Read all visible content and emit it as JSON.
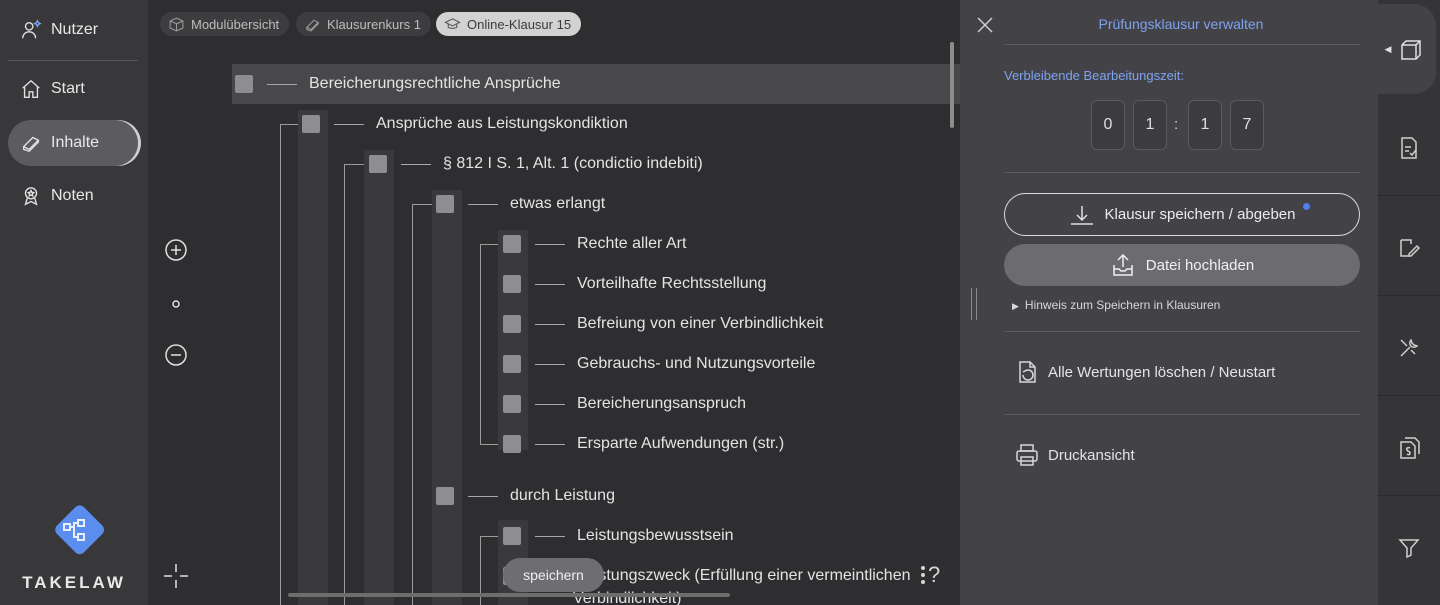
{
  "sidebar": {
    "items": [
      {
        "label": "Nutzer",
        "icon": "user-icon"
      },
      {
        "label": "Start",
        "icon": "home-icon"
      },
      {
        "label": "Inhalte",
        "icon": "book-icon",
        "active": true
      },
      {
        "label": "Noten",
        "icon": "award-icon"
      }
    ],
    "brand": "TAKELAW"
  },
  "breadcrumb": [
    "Modulübersicht",
    "Klausurenkurs 1",
    "Online-Klausur 15"
  ],
  "tree": [
    {
      "label": "Bereicherungsrechtliche Ansprüche",
      "level": 0
    },
    {
      "label": "Ansprüche aus Leistungskondiktion",
      "level": 1
    },
    {
      "label": "§ 812 I S. 1, Alt. 1 (condictio indebiti)",
      "level": 2
    },
    {
      "label": "etwas erlangt",
      "level": 3
    },
    {
      "label": "Rechte aller Art",
      "level": 4
    },
    {
      "label": "Vorteilhafte Rechtsstellung",
      "level": 4
    },
    {
      "label": "Befreiung von einer Verbindlichkeit",
      "level": 4
    },
    {
      "label": "Gebrauchs- und Nutzungsvorteile",
      "level": 4
    },
    {
      "label": "Bereicherungsanspruch",
      "level": 4
    },
    {
      "label": "Ersparte Aufwendungen (str.)",
      "level": 4
    },
    {
      "label": "durch Leistung",
      "level": 3
    },
    {
      "label": "Leistungsbewusstsein",
      "level": 4
    },
    {
      "label": "Leistungszweck (Erfüllung einer vermeintlichen",
      "level": 4
    },
    {
      "label": "Verbindlichkeit)",
      "level": 4
    }
  ],
  "canvas": {
    "save_label": "speichern",
    "help_label": "?"
  },
  "panel": {
    "title": "Prüfungsklausur verwalten",
    "time_label": "Verbleibende Bearbeitungszeit:",
    "time_digits": [
      "0",
      "1",
      "1",
      "7"
    ],
    "time_separator": ":",
    "save_button": "Klausur speichern / abgeben",
    "upload_button": "Datei hochladen",
    "hint": "Hinweis zum Speichern in Klausuren",
    "reset": "Alle Wertungen löschen / Neustart",
    "print": "Druckansicht"
  },
  "colors": {
    "accent": "#7fa2f0",
    "dot": "#4f80f0"
  }
}
